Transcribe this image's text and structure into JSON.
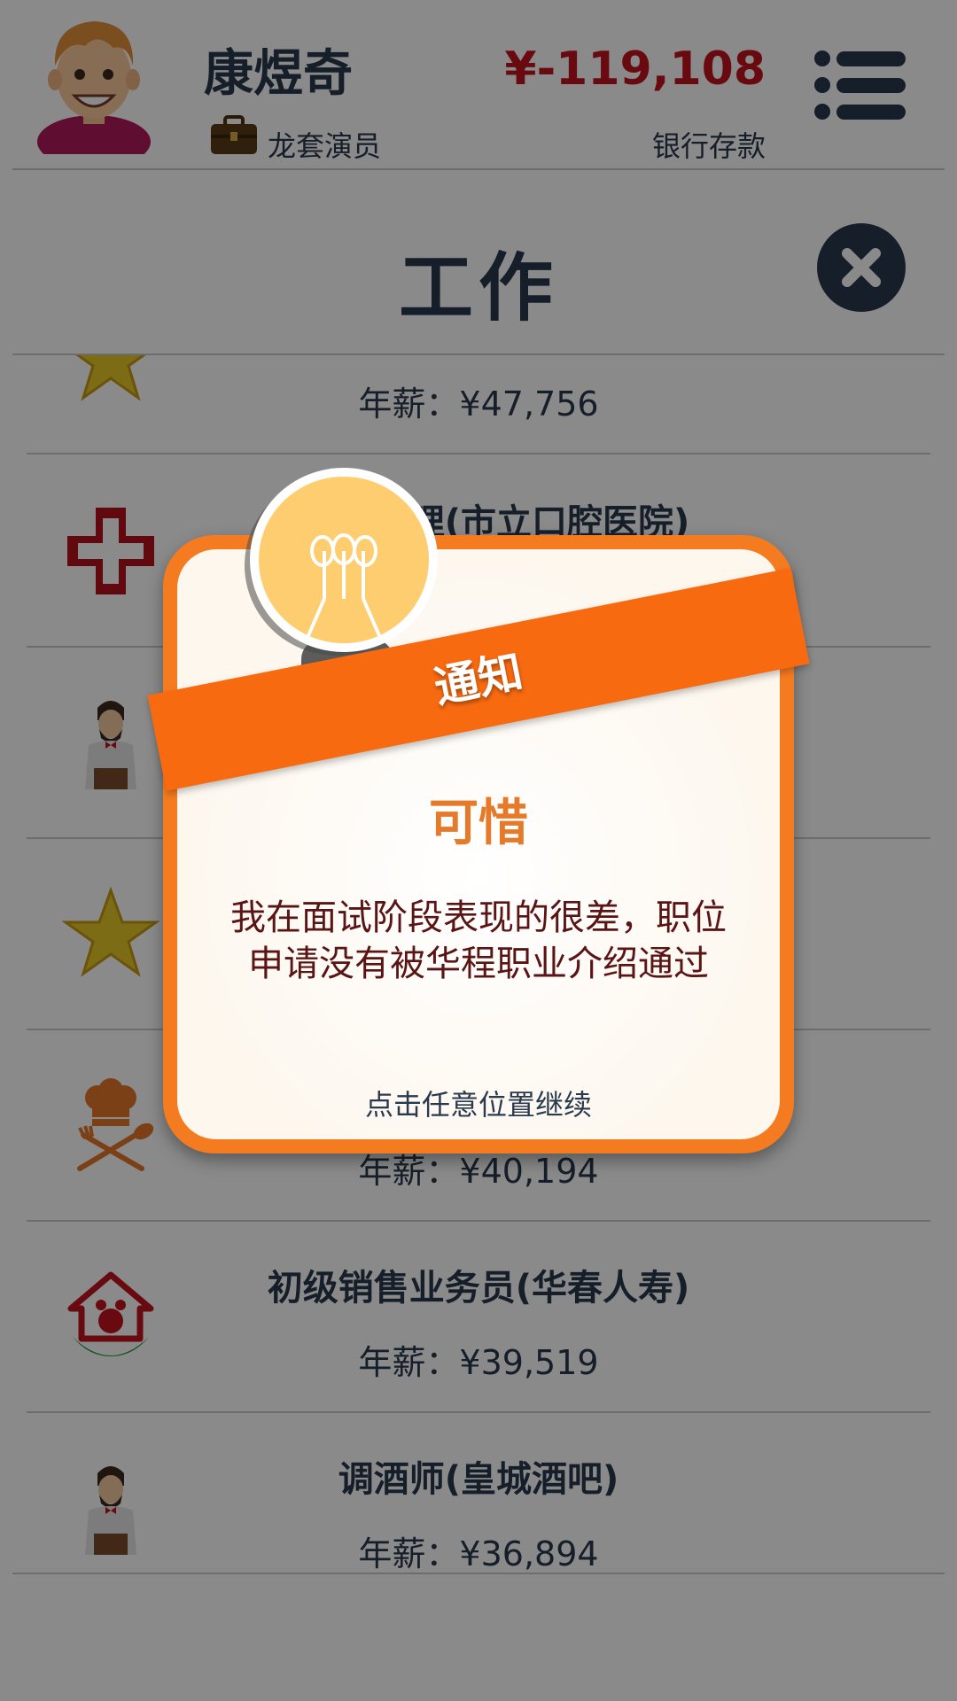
{
  "player": {
    "name": "康煜奇",
    "job": "龙套演员",
    "balance": "¥-119,108",
    "balance_label": "银行存款",
    "balance_color": "#c0141c"
  },
  "section": {
    "title": "工作"
  },
  "jobs": [
    {
      "name": "",
      "salary": "年薪：¥47,756",
      "icon": "star-icon"
    },
    {
      "name": "口腔科护理(市立口腔医院)",
      "salary": "",
      "icon": "medical-cross-icon"
    },
    {
      "name": "",
      "salary": "",
      "icon": "bartender-icon"
    },
    {
      "name": "",
      "salary": "",
      "icon": "star-icon"
    },
    {
      "name": "",
      "salary": "年薪：¥40,194",
      "icon": "chef-icon"
    },
    {
      "name": "初级销售业务员(华春人寿)",
      "salary": "年薪：¥39,519",
      "icon": "insurance-house-icon"
    },
    {
      "name": "调酒师(皇城酒吧)",
      "salary": "年薪：¥36,894",
      "icon": "bartender-icon"
    }
  ],
  "dialog": {
    "banner": "通知",
    "heading": "可惜",
    "message": "我在面试阶段表现的很差，职位申请没有被华程职业介绍通过",
    "hint": "点击任意位置继续",
    "frame_color": "#f47b20",
    "banner_color": "#f86a10"
  }
}
